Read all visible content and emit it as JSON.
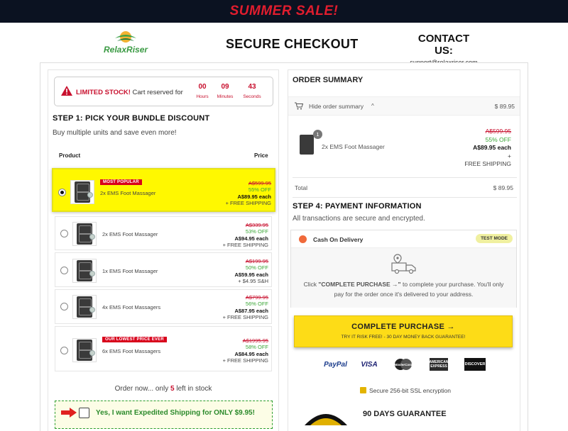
{
  "banner": {
    "text": "SUMMER SALE!"
  },
  "header": {
    "logo_text": "RelaxRiser",
    "title": "SECURE CHECKOUT",
    "contact_title": "CONTACT US:",
    "contact_email": "support@relaxriser.com"
  },
  "stock_notice": {
    "label_bold": "LIMITED STOCK!",
    "label_rest": " Cart reserved for",
    "timer": [
      {
        "value": "00",
        "unit": "Hours"
      },
      {
        "value": "09",
        "unit": "Minutes"
      },
      {
        "value": "43",
        "unit": "Seconds"
      }
    ]
  },
  "step1": {
    "title": "STEP 1: PICK YOUR BUNDLE DISCOUNT",
    "subtitle": "Buy multiple units and save even more!",
    "col_product": "Product",
    "col_price": "Price",
    "bundles": [
      {
        "name": "2x EMS Foot Massager",
        "tag": "MOST POPULAR",
        "old": "A$599.95",
        "off": "55% OFF",
        "each": "A$89.95 each",
        "ship": "+ FREE SHIPPING",
        "selected": true
      },
      {
        "name": "2x EMS Foot Massager",
        "tag": "",
        "old": "A$339.95",
        "off": "53% OFF",
        "each": "A$94.95 each",
        "ship": "+ FREE SHIPPING",
        "selected": false
      },
      {
        "name": "1x EMS Foot Massager",
        "tag": "",
        "old": "A$199.95",
        "off": "50% OFF",
        "each": "A$59.95 each",
        "ship": "+ $4.95 S&H",
        "selected": false
      },
      {
        "name": "4x EMS Foot Massagers",
        "tag": "",
        "old": "A$799.95",
        "off": "56% OFF",
        "each": "A$87.95 each",
        "ship": "+ FREE SHIPPING",
        "selected": false
      },
      {
        "name": "6x EMS Foot Massagers",
        "tag": "OUR LOWEST PRICE EVER",
        "old": "A$1995.95",
        "off": "58% OFF",
        "each": "A$84.95 each",
        "ship": "+ FREE SHIPPING",
        "selected": false
      }
    ],
    "stock_pre": "Order now... only ",
    "stock_count": "5",
    "stock_post": " left in stock",
    "expedited": "Yes, I want Expedited Shipping for ONLY $9.95!"
  },
  "order_summary": {
    "title": "ORDER SUMMARY",
    "toggle": "Hide order summary",
    "bar_total": "$ 89.95",
    "item": {
      "qty": "1",
      "name": "2x EMS Foot Massager",
      "old": "A$599.95",
      "off": "55% OFF",
      "each": "A$89.95 each",
      "plus": "+",
      "ship": "FREE  SHIPPING"
    },
    "total_label": "Total",
    "total_value": "$ 89.95"
  },
  "payment": {
    "title": "STEP 4: PAYMENT INFORMATION",
    "subtitle": "All transactions are secure and encrypted.",
    "method": "Cash On Delivery",
    "mode_badge": "TEST MODE",
    "text_pre": "Click ",
    "text_bold": "\"COMPLETE PURCHASE →\"",
    "text_post": " to complete your purchase. You'll only pay for the order once it's delivered to your address.",
    "button_main": "COMPLETE PURCHASE →",
    "button_sub": "TRY IT RISK FREE! - 30 DAY MONEY BACK GUARANTEE!",
    "logos": [
      "PayPal",
      "VISA",
      "MasterCard",
      "AMERICAN EXPRESS",
      "DISCOVER"
    ],
    "ssl": "Secure 256-bit SSL encryption",
    "guarantee": "90 DAYS GUARANTEE"
  },
  "colors": {
    "accent_red": "#c8102e",
    "selected_yellow": "#fff800",
    "button_yellow": "#fddc17",
    "green": "#3aa636"
  }
}
